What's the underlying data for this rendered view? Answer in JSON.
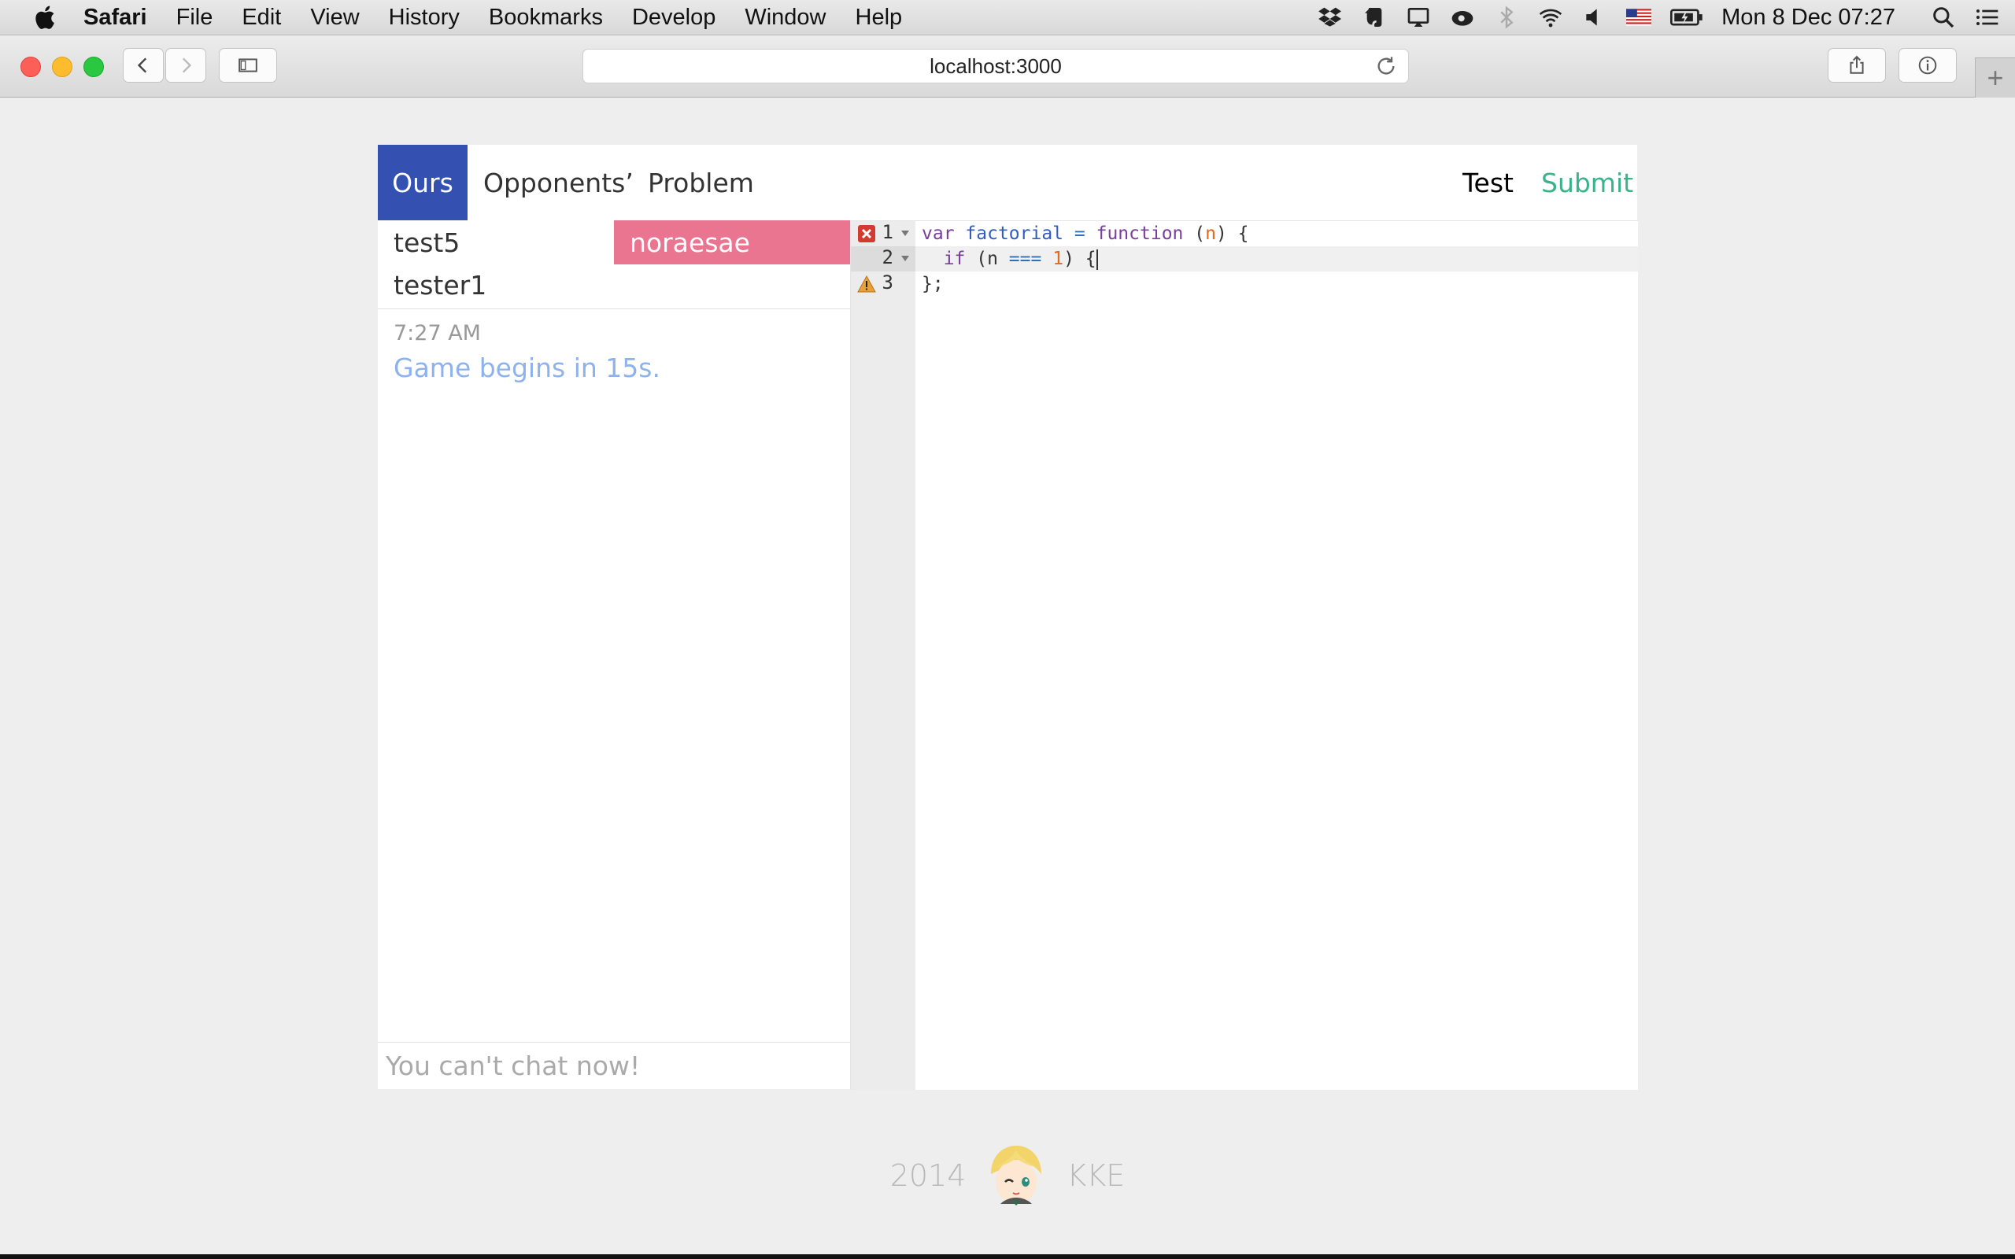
{
  "menubar": {
    "app": "Safari",
    "items": [
      "File",
      "Edit",
      "View",
      "History",
      "Bookmarks",
      "Develop",
      "Window",
      "Help"
    ],
    "tray_icons": [
      "dropbox-icon",
      "evernote-icon",
      "airplay-icon",
      "creative-cloud-icon",
      "bluetooth-icon",
      "wifi-icon",
      "volume-icon",
      "flag-us-icon",
      "battery-icon"
    ],
    "clock": "Mon 8 Dec  07:27"
  },
  "browser": {
    "address": "localhost:3000"
  },
  "nav": {
    "tabs": [
      "Ours",
      "Opponents’",
      "Problem"
    ],
    "active_tab": "Ours",
    "test_label": "Test",
    "submit_label": "Submit",
    "accent_color": "#3451b2",
    "submit_color": "#3bb38a"
  },
  "players": {
    "left": [
      "test5",
      "tester1"
    ],
    "right": [
      "noraesae"
    ],
    "highlight_color": "#e97591"
  },
  "chat": {
    "time": "7:27 AM",
    "message": "Game begins in 15s.",
    "input_placeholder": "You can't chat now!"
  },
  "editor": {
    "lines": [
      {
        "num": "1",
        "marker": "error"
      },
      {
        "num": "2",
        "marker": ""
      },
      {
        "num": "3",
        "marker": "warning"
      }
    ]
  },
  "footer": {
    "year": "2014",
    "name": "KKE"
  }
}
